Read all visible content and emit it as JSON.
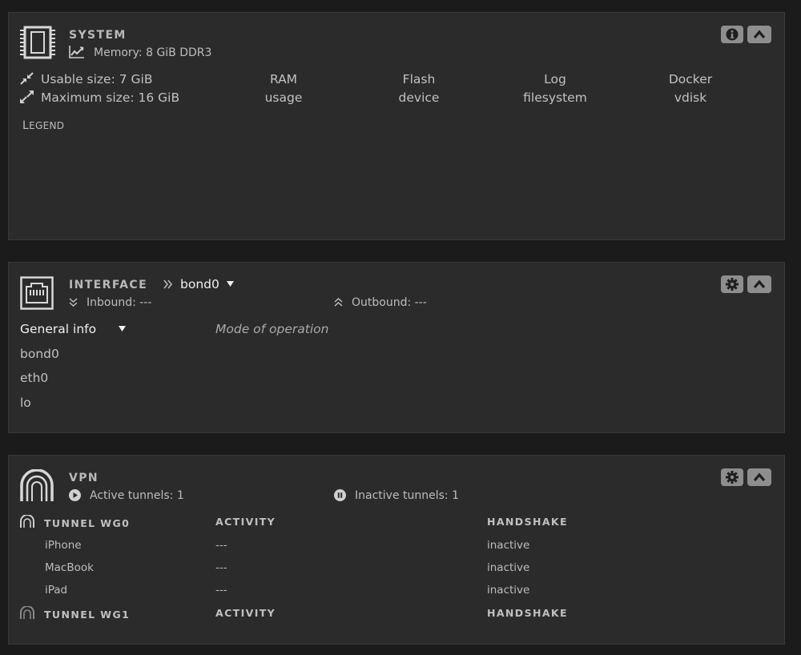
{
  "system": {
    "title": "SYSTEM",
    "memory": "Memory: 8 GiB DDR3",
    "usable": "Usable size: 7 GiB",
    "maximum": "Maximum size: 16 GiB",
    "columns": [
      {
        "line1": "RAM",
        "line2": "usage"
      },
      {
        "line1": "Flash",
        "line2": "device"
      },
      {
        "line1": "Log",
        "line2": "filesystem"
      },
      {
        "line1": "Docker",
        "line2": "vdisk"
      }
    ],
    "legend_first": "L",
    "legend_rest": "EGEND",
    "icons": [
      "memory-chip-icon",
      "chart-line-icon",
      "compress-icon",
      "expand-icon",
      "info-icon",
      "chevron-up-icon"
    ]
  },
  "interface": {
    "title": "INTERFACE",
    "selected_port": "bond0",
    "inbound": "Inbound: ---",
    "outbound": "Outbound: ---",
    "info_select": "General info",
    "mode_label": "Mode of operation",
    "ports": [
      "bond0",
      "eth0",
      "lo"
    ],
    "icons": [
      "ethernet-port-icon",
      "double-chevron-right-icon",
      "caret-down-icon",
      "double-chevron-down-icon",
      "double-chevron-up-icon",
      "gear-icon",
      "chevron-up-icon"
    ]
  },
  "vpn": {
    "title": "VPN",
    "active": "Active tunnels: 1",
    "inactive": "Inactive tunnels: 1",
    "tunnels": [
      {
        "name": "TUNNEL WG0",
        "activity_header": "ACTIVITY",
        "handshake_header": "HANDSHAKE",
        "peers": [
          {
            "name": "iPhone",
            "activity": "---",
            "handshake": "inactive"
          },
          {
            "name": "MacBook",
            "activity": "---",
            "handshake": "inactive"
          },
          {
            "name": "iPad",
            "activity": "---",
            "handshake": "inactive"
          }
        ]
      },
      {
        "name": "TUNNEL WG1",
        "activity_header": "ACTIVITY",
        "handshake_header": "HANDSHAKE",
        "peers": []
      }
    ],
    "icons": [
      "vpn-arch-icon",
      "play-circle-icon",
      "pause-circle-icon",
      "tunnel-icon",
      "gear-icon",
      "chevron-up-icon"
    ]
  },
  "colors": {
    "page_bg": "#1c1b1b",
    "panel_bg": "#2b2b2b",
    "button_bg": "#8e8e8e",
    "text": "#c8c8c8"
  }
}
